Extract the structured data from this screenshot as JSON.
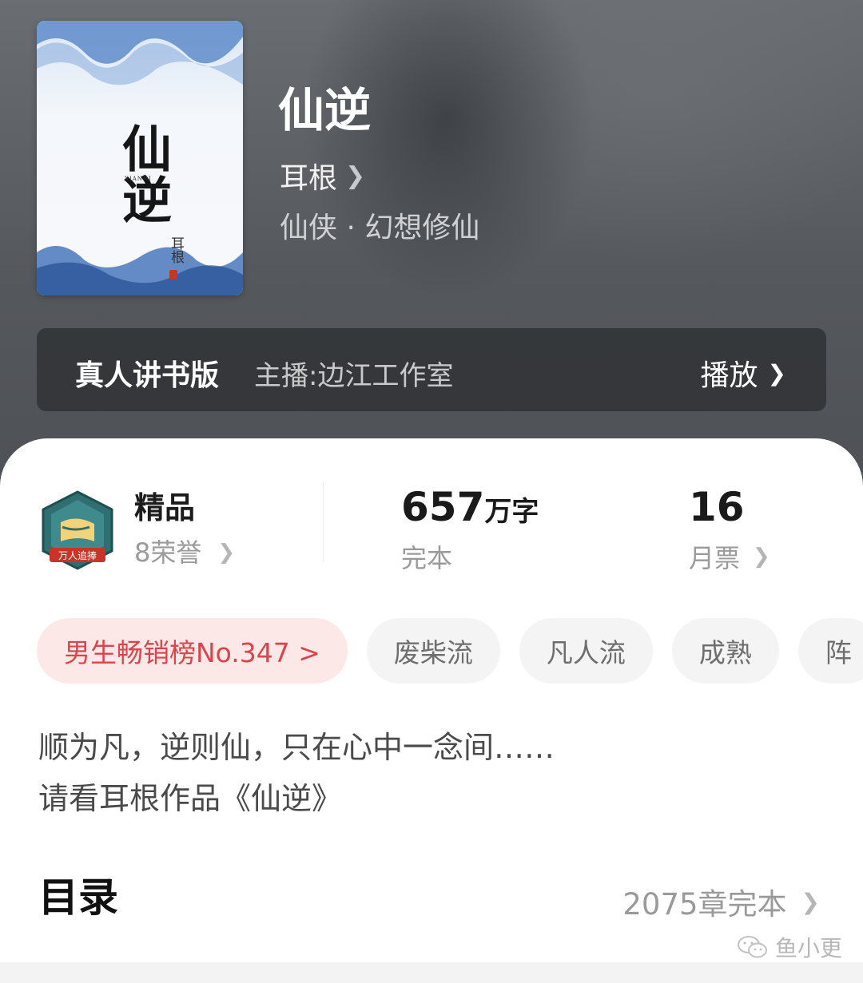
{
  "book": {
    "title": "仙逆",
    "author": "耳根",
    "genre": "仙侠 · 幻想修仙",
    "cover_title": "仙逆",
    "cover_pinyin": "XIANNI",
    "cover_author": "耳根"
  },
  "audio": {
    "label": "真人讲书版",
    "host": "主播:边江工作室",
    "play_label": "播放"
  },
  "stats": {
    "quality_title": "精品",
    "honors": "8荣誉",
    "badge_text": "万人追捧",
    "word_count": "657",
    "word_unit": "万字",
    "status": "完本",
    "monthly_votes": "16",
    "monthly_votes_label": "月票"
  },
  "tags": [
    "男生畅销榜No.347 >",
    "废柴流",
    "凡人流",
    "成熟",
    "阵"
  ],
  "description": {
    "line1": "顺为凡，逆则仙，只在心中一念间……",
    "line2": "请看耳根作品《仙逆》"
  },
  "toc": {
    "title": "目录",
    "info": "2075章完本"
  },
  "watermark": "鱼小更",
  "icons": {
    "chevron": "chevron-right-icon",
    "badge": "honor-badge-icon",
    "watermark": "wechat-icon"
  },
  "colors": {
    "rank_tag_bg": "#fde8e8",
    "rank_tag_text": "#d9454a",
    "card_bg": "#ffffff"
  }
}
